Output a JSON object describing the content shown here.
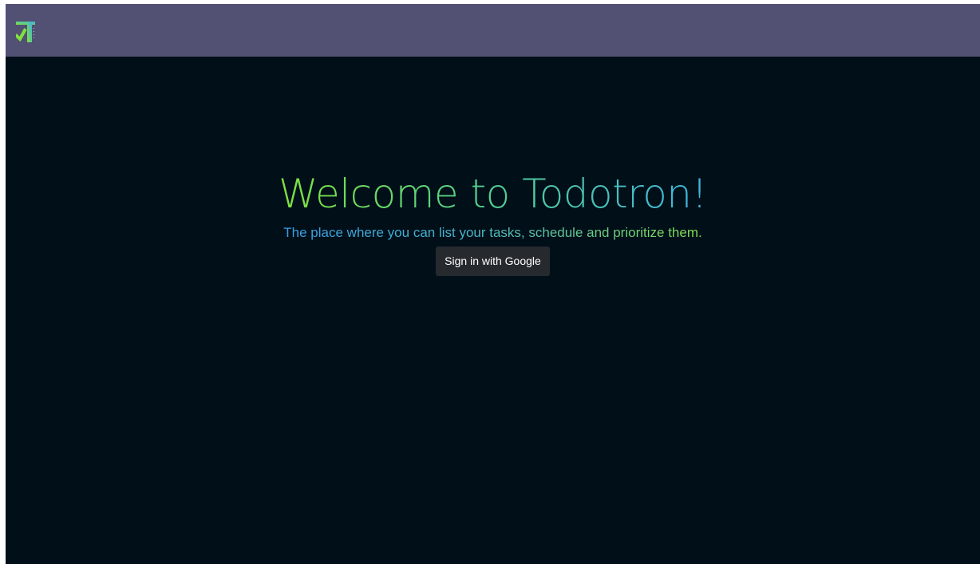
{
  "navbar": {
    "logo_icon": "todotron-logo-icon",
    "background_color": "#525073"
  },
  "hero": {
    "title": "Welcome to Todotron!",
    "subtitle": "The place where you can list your tasks, schedule and prioritize them.",
    "signin_label": "Sign in with Google"
  },
  "colors": {
    "page_background": "#010f19",
    "title_gradient": [
      "#7fe23f",
      "#3fb3dc"
    ],
    "subtitle_gradient": [
      "#3aa0e8",
      "#86e04e"
    ],
    "button_background": "#262a2f"
  }
}
